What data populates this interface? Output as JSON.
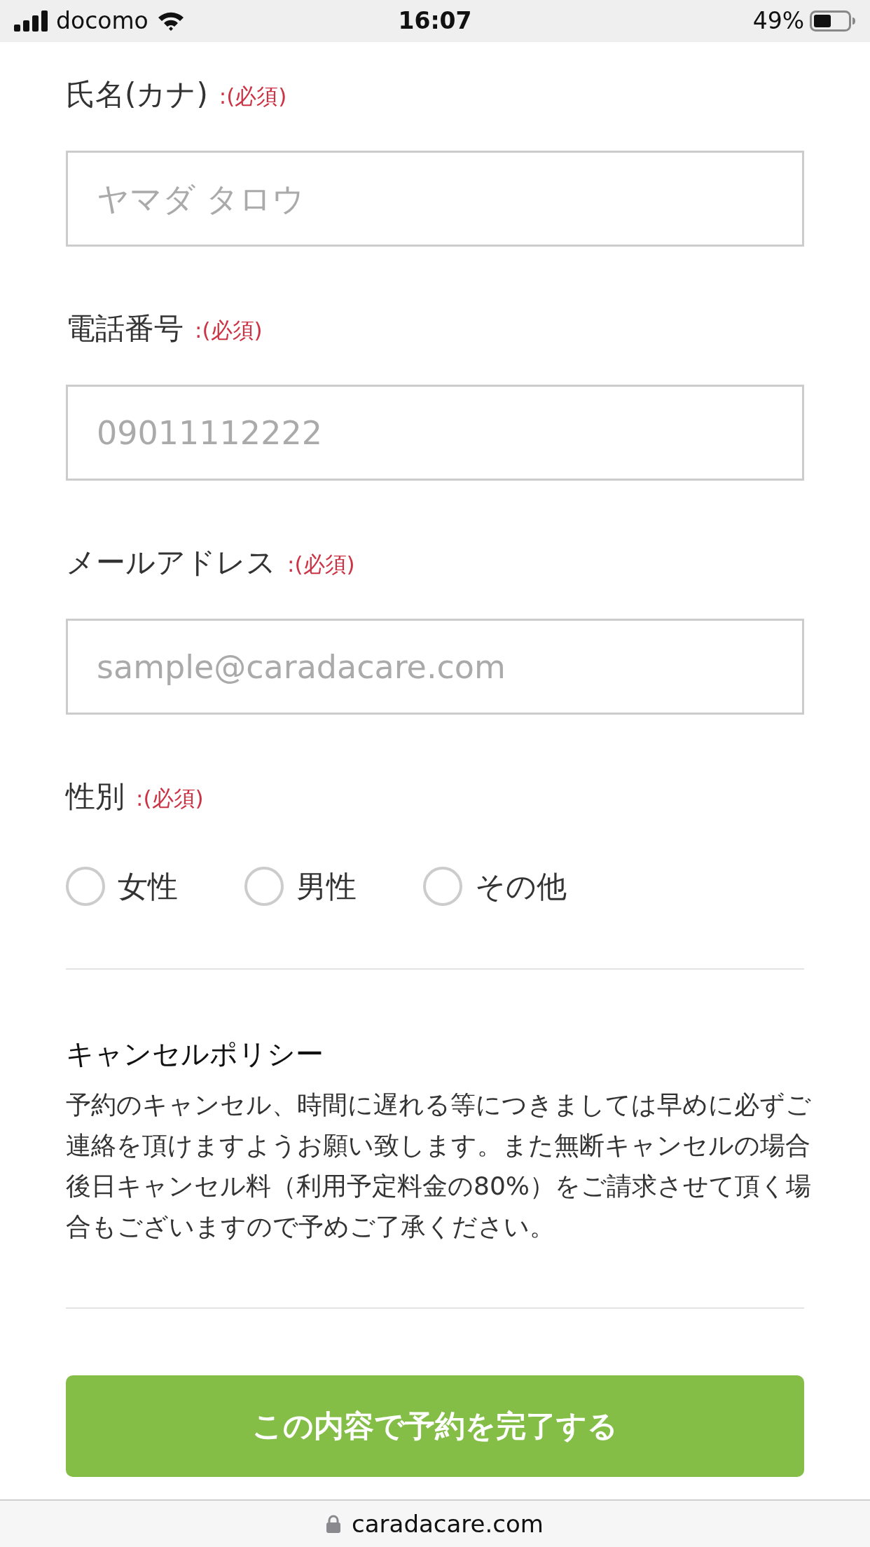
{
  "status_bar": {
    "carrier": "docomo",
    "time": "16:07",
    "battery": "49%"
  },
  "form": {
    "fields": [
      {
        "label": "氏名(カナ)",
        "required": ":(必須)",
        "placeholder": "ヤマダ タロウ"
      },
      {
        "label": "電話番号",
        "required": ":(必須)",
        "placeholder": "09011112222"
      },
      {
        "label": "メールアドレス",
        "required": ":(必須)",
        "placeholder": "sample@caradacare.com"
      }
    ],
    "gender": {
      "label": "性別",
      "required": ":(必須)",
      "options": [
        {
          "label": "女性",
          "selected": false
        },
        {
          "label": "男性",
          "selected": false
        },
        {
          "label": "その他",
          "selected": false
        }
      ]
    }
  },
  "cancel_policy": {
    "title": "キャンセルポリシー",
    "text": "予約のキャンセル、時間に遅れる等につきましては早めに必ずご連絡を頂けますようお願い致します。また無断キャンセルの場合後日キャンセル料（利用予定料金の80%）をご請求させて頂く場合もございますので予めご了承ください。"
  },
  "submit_button": {
    "label": "この内容で予約を完了する"
  },
  "address_bar": {
    "url": "caradacare.com"
  }
}
